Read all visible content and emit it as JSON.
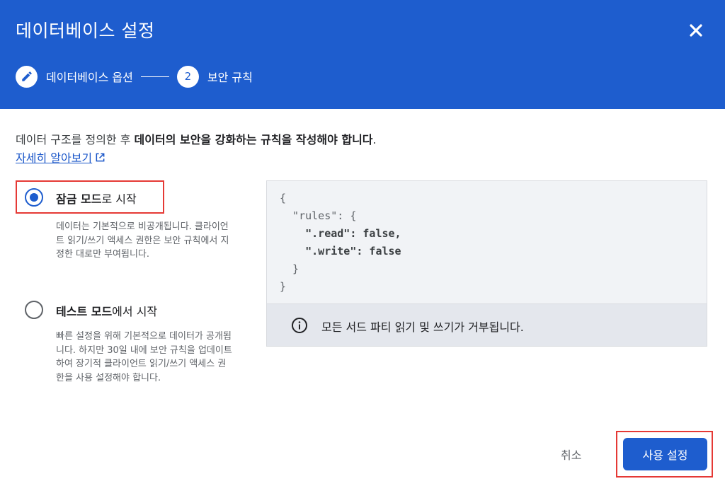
{
  "dialog": {
    "title": "데이터베이스 설정",
    "close_icon": "close-icon"
  },
  "steps": [
    {
      "label": "데이터베이스 옵션",
      "icon": "pencil-icon",
      "status": "completed"
    },
    {
      "number": "2",
      "label": "보안 규칙",
      "status": "active"
    }
  ],
  "intro": {
    "prefix": "데이터 구조를 정의한 후 ",
    "bold": "데이터의 보안을 강화하는 규칙을 작성해야 합니다",
    "suffix": ".",
    "learn_more": "자세히 알아보기",
    "learn_more_icon": "external-link-icon"
  },
  "options": [
    {
      "bold": "잠금 모드",
      "rest": "로 시작",
      "selected": true,
      "description": "데이터는 기본적으로 비공개됩니다. 클라이언트 읽기/쓰기 액세스 권한은 보안 규칙에서 지정한 대로만 부여됩니다."
    },
    {
      "bold": "테스트 모드",
      "rest": "에서 시작",
      "selected": false,
      "description": "빠른 설정을 위해 기본적으로 데이터가 공개됩니다. 하지만 30일 내에 보안 규칙을 업데이트하여 장기적 클라이언트 읽기/쓰기 액세스 권한을 사용 설정해야 합니다."
    }
  ],
  "code": {
    "lines": [
      "{",
      "  \"rules\": {",
      "    \".read\": false,",
      "    \".write\": false",
      "  }",
      "}"
    ],
    "info_icon": "info-icon",
    "info_text": "모든 서드 파티 읽기 및 쓰기가 거부됩니다."
  },
  "footer": {
    "cancel_label": "취소",
    "submit_label": "사용 설정"
  },
  "colors": {
    "header": "#1e5dce",
    "primary": "#1e5dce",
    "highlight": "#e53935"
  }
}
